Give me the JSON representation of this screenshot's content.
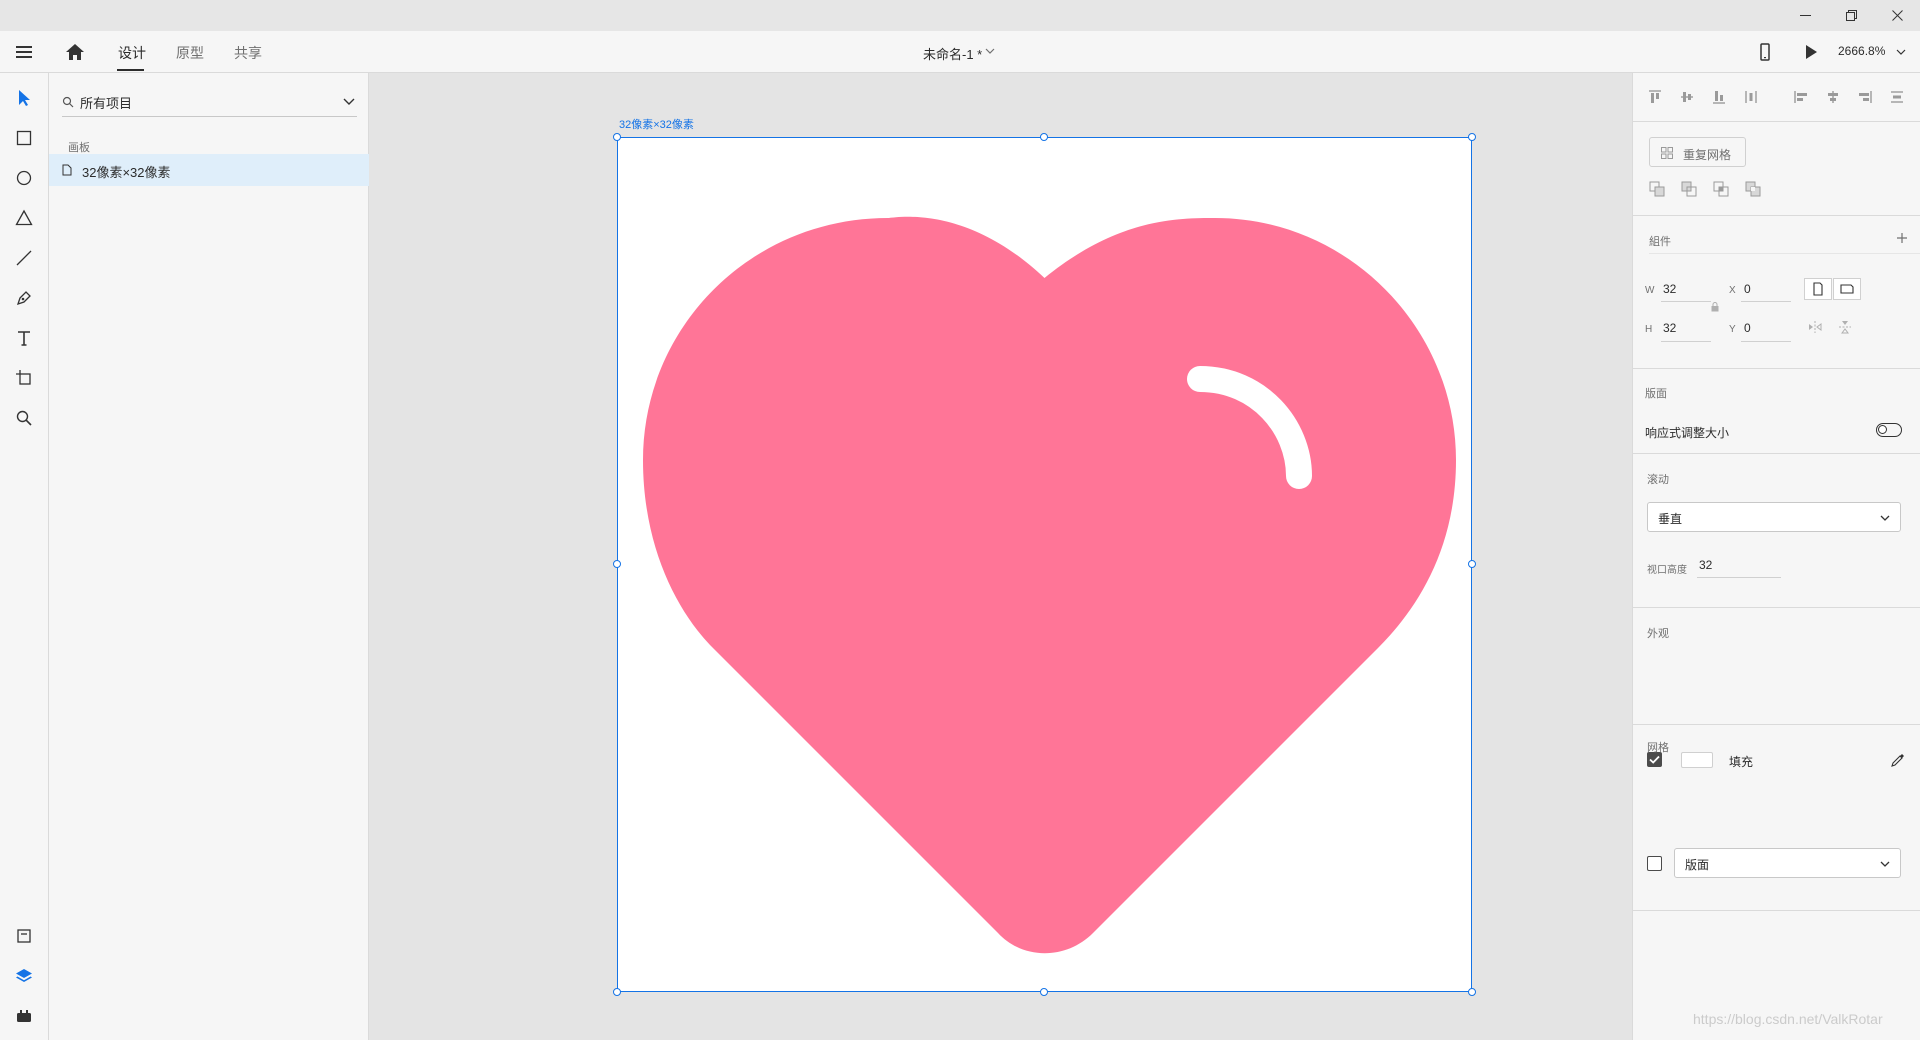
{
  "window": {
    "controls": [
      "minimize-icon",
      "restore-icon",
      "close-icon"
    ]
  },
  "menubar": {
    "tabs": [
      {
        "label": "设计",
        "active": true
      },
      {
        "label": "原型",
        "active": false
      },
      {
        "label": "共享",
        "active": false
      }
    ],
    "document_title": "未命名-1 *",
    "zoom": "2666.8%"
  },
  "toolbar": {
    "tools": [
      "select-icon",
      "rectangle-icon",
      "ellipse-icon",
      "polygon-icon",
      "line-icon",
      "pen-icon",
      "text-icon",
      "artboard-icon",
      "zoom-icon"
    ],
    "bottom_tools": [
      "assets-icon",
      "layers-icon",
      "plugins-icon"
    ],
    "accent_color": "#1473e6"
  },
  "layers_panel": {
    "search_placeholder": "所有项目",
    "section_label": "画板",
    "items": [
      {
        "label": "32像素×32像素",
        "selected": true
      }
    ]
  },
  "canvas": {
    "artboard_name": "32像素×32像素",
    "heart_color": "#ff7597",
    "highlight_color": "#ffffff",
    "watermark": "https://blog.csdn.net/ValkRotar"
  },
  "properties": {
    "repeat_grid_label": "重复网格",
    "component_label": "組件",
    "transform": {
      "w_label": "W",
      "w_value": "32",
      "h_label": "H",
      "h_value": "32",
      "x_label": "X",
      "x_value": "0",
      "y_label": "Y",
      "y_value": "0"
    },
    "layout_label": "版面",
    "responsive_resize_label": "响应式调整大小",
    "responsive_resize_on": false,
    "scroll_label": "滚动",
    "scroll_value": "垂直",
    "viewport_height_label": "视口高度",
    "viewport_height_value": "32",
    "appearance_label": "外观",
    "fill_label": "填充",
    "fill_checked": true,
    "fill_color": "#ffffff",
    "grid_label": "网格",
    "grid_checked": false,
    "grid_value": "版面"
  }
}
